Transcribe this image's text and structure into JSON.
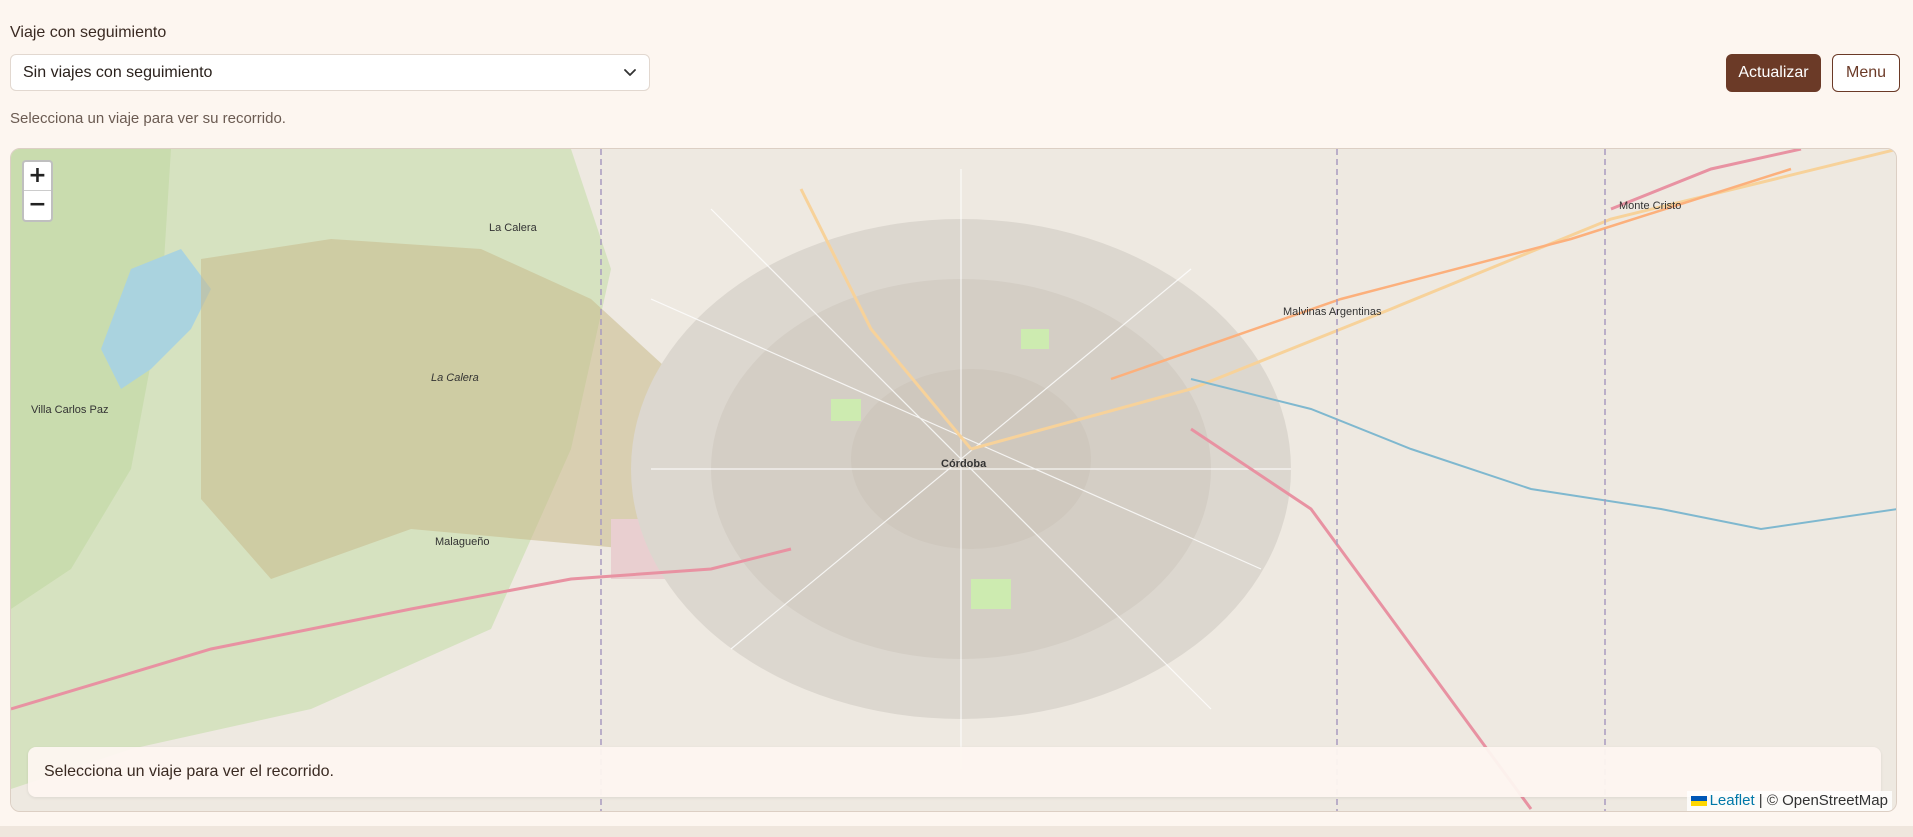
{
  "trip_selector": {
    "label": "Viaje con seguimiento",
    "selected": "Sin viajes con seguimiento"
  },
  "hint": "Selecciona un viaje para ver su recorrido.",
  "buttons": {
    "refresh": "Actualizar",
    "menu": "Menu"
  },
  "map": {
    "zoom_in": "+",
    "zoom_out": "−",
    "status": "Selecciona un viaje para ver el recorrido.",
    "attribution": {
      "leaflet": "Leaflet",
      "separator": " | © OpenStreetMap"
    },
    "labels": [
      "Córdoba",
      "La Calera",
      "Malvinas Argentinas",
      "Monte Cristo",
      "Malagueño",
      "Villa Carlos Paz"
    ]
  },
  "colors": {
    "primary": "#6b3a27",
    "background": "#fdf6f0",
    "link": "#0078a8"
  }
}
